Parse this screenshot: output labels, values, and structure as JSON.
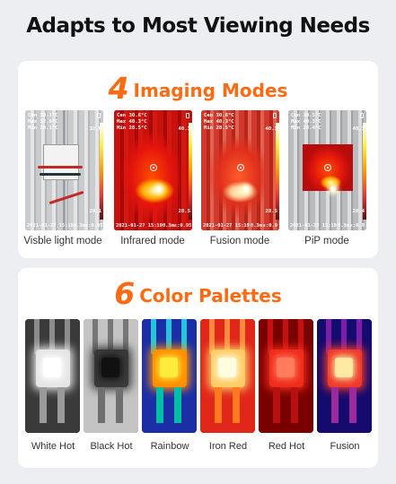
{
  "title": "Adapts to Most Viewing Needs",
  "modes_section": {
    "number": "4",
    "heading": "Imaging Modes",
    "items": [
      {
        "label": "Visble light mode",
        "hud": "Cen 30.1°C\nMax 32.0°C\nMin 28.1°C",
        "right": "32.0",
        "min": "28.1",
        "date": "2021-01-27 15:19",
        "dist": "0.3m",
        "emis": "ε:0.95"
      },
      {
        "label": "Infrared mode",
        "hud": "Cen 30.6°C\nMax 40.3°C\nMin 28.5°C",
        "right": "40.3",
        "min": "28.5",
        "date": "2021-01-27 15:19",
        "dist": "0.3m",
        "emis": "ε:0.95"
      },
      {
        "label": "Fusion mode",
        "hud": "Cen 30.6°C\nMax 40.3°C\nMin 28.5°C",
        "right": "40.3",
        "min": "28.5",
        "date": "2021-01-27 15:19",
        "dist": "0.3m",
        "emis": "ε:0.9"
      },
      {
        "label": "PiP mode",
        "hud": "Cen 30.5°C\nMax 40.3°C\nMin 28.4°C",
        "right": "40.3",
        "min": "28.4",
        "date": "2021-01-27 15:19",
        "dist": "0.3m",
        "emis": "ε:0.9"
      }
    ]
  },
  "palettes_section": {
    "number": "6",
    "heading": "Color Palettes",
    "items": [
      {
        "label": "White Hot",
        "colors": {
          "bg": "#3a3a3a",
          "bar": "#8c8c8c",
          "box": "#e6e6e6",
          "core": "#ffffff",
          "leg": "#9a9a9a"
        }
      },
      {
        "label": "Black Hot",
        "colors": {
          "bg": "#c4c4c4",
          "bar": "#777777",
          "box": "#3a3a3a",
          "core": "#111111",
          "leg": "#6f6f6f"
        }
      },
      {
        "label": "Rainbow",
        "colors": {
          "bg": "#1b2ea6",
          "bar": "#26c6da",
          "box": "#ff8f00",
          "core": "#ffeb3b",
          "leg": "#00bfa5"
        }
      },
      {
        "label": "Iron Red",
        "colors": {
          "bg": "#e0271a",
          "bar": "#ff8a3d",
          "box": "#ffcc66",
          "core": "#fffde0",
          "leg": "#ff7a1f"
        }
      },
      {
        "label": "Red Hot",
        "colors": {
          "bg": "#7a0000",
          "bar": "#c41010",
          "box": "#f02c1c",
          "core": "#ff7b5c",
          "leg": "#b81010"
        }
      },
      {
        "label": "Fusion",
        "colors": {
          "bg": "#150a6e",
          "bar": "#7d1da8",
          "box": "#ef3a2a",
          "core": "#ffe8a0",
          "leg": "#9c2a9c"
        }
      }
    ]
  }
}
